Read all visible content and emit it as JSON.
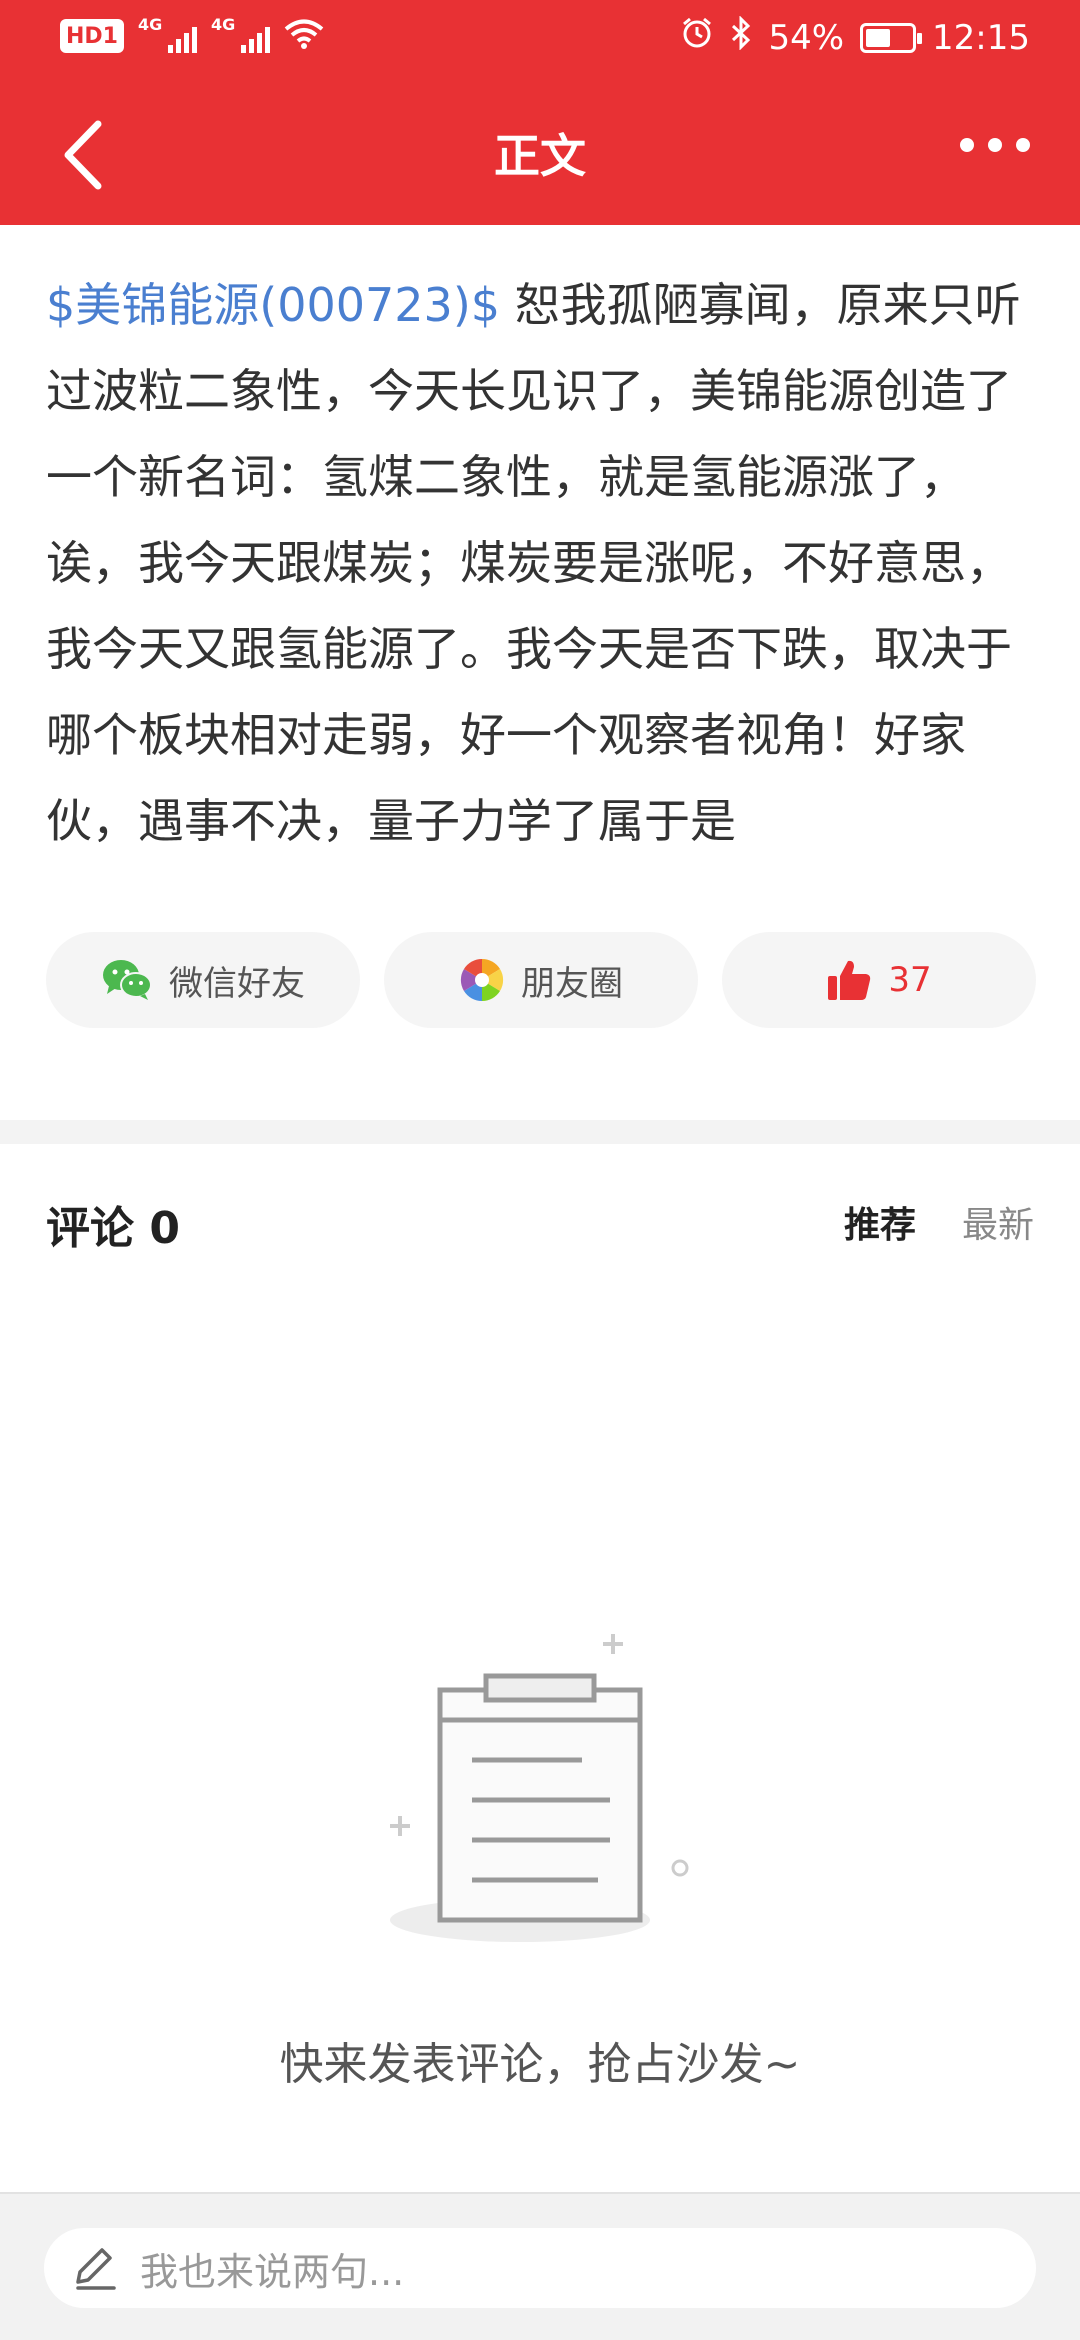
{
  "status_bar": {
    "network_badge": "HD1",
    "signal1_label": "4G",
    "signal2_label": "4G",
    "battery_percent": "54%",
    "battery_level": 0.54,
    "time": "12:15"
  },
  "header": {
    "title": "正文",
    "back_icon": "chevron-left-icon",
    "more_icon": "more-horizontal-icon"
  },
  "article": {
    "stock_link": "$美锦能源(000723)$",
    "body": " 恕我孤陋寡闻，原来只听过波粒二象性，今天长见识了，美锦能源创造了一个新名词：氢煤二象性，就是氢能源涨了，诶，我今天跟煤炭；煤炭要是涨呢，不好意思，我今天又跟氢能源了。我今天是否下跌，取决于哪个板块相对走弱，好一个观察者视角！好家伙，遇事不决，量子力学了属于是"
  },
  "share": {
    "wechat_label": "微信好友",
    "moments_label": "朋友圈",
    "like_count": "37"
  },
  "comments": {
    "title": "评论 0",
    "sort_recommended": "推荐",
    "sort_latest": "最新",
    "empty_text": "快来发表评论，抢占沙发~"
  },
  "composer": {
    "placeholder": "我也来说两句..."
  },
  "colors": {
    "brand_red": "#e83134",
    "link_blue": "#4a7fd0",
    "wechat_green": "#4cb84f"
  }
}
